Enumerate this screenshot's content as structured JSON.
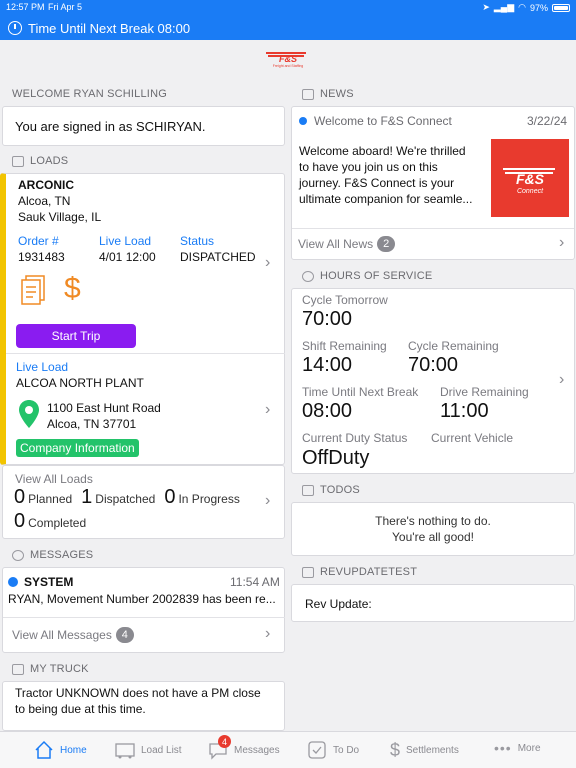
{
  "status_bar": {
    "time": "12:57 PM",
    "date": "Fri Apr 5",
    "battery": "97%"
  },
  "banner": {
    "text": "Time Until Next Break 08:00"
  },
  "logo": {
    "text": "F&S",
    "subtext": "Freight and Staffing"
  },
  "welcome": {
    "header": "WELCOME RYAN SCHILLING",
    "signed_in": "You are signed in as SCHIRYAN."
  },
  "loads": {
    "header": "LOADS",
    "customer": "ARCONIC",
    "city1": "Alcoa, TN",
    "city2": "Sauk Village, IL",
    "order_label": "Order #",
    "order_value": "1931483",
    "live_label": "Live Load",
    "live_value": "4/01 12:00",
    "status_label": "Status",
    "status_value": "DISPATCHED",
    "dollar": "$",
    "start_trip": "Start Trip",
    "stop_type": "Live Load",
    "stop_name": "ALCOA NORTH PLANT",
    "address1": "1100 East Hunt Road",
    "address2": "Alcoa, TN 37701",
    "company_info": "Company Information",
    "view_all": "View All Loads",
    "planned_count": "0",
    "planned_label": "Planned",
    "dispatched_count": "1",
    "dispatched_label": "Dispatched",
    "progress_count": "0",
    "progress_label": "In Progress",
    "completed_count": "0",
    "completed_label": "Completed"
  },
  "messages": {
    "header": "MESSAGES",
    "sender": "SYSTEM",
    "time": "11:54 AM",
    "preview": "RYAN, Movement Number 2002839 has been re...",
    "view_all": "View All Messages",
    "count": "4"
  },
  "my_truck": {
    "header": "MY TRUCK",
    "text1": "Tractor UNKNOWN does not have a PM close",
    "text2": "to being due at this time."
  },
  "news": {
    "header": "NEWS",
    "title": "Welcome to F&S Connect",
    "date": "3/22/24",
    "body1": "Welcome aboard! We're thrilled",
    "body2": "to have you join us on this",
    "body3": "journey. F&S Connect is your",
    "body4": "ultimate companion for seamle...",
    "thumb_text": "F&S",
    "thumb_sub": "Connect",
    "view_all": "View All News",
    "count": "2"
  },
  "hos": {
    "header": "HOURS OF SERVICE",
    "cycle_tomorrow_label": "Cycle Tomorrow",
    "cycle_tomorrow_value": "70:00",
    "shift_label": "Shift Remaining",
    "shift_value": "14:00",
    "cycle_label": "Cycle Remaining",
    "cycle_value": "70:00",
    "break_label": "Time Until Next Break",
    "break_value": "08:00",
    "drive_label": "Drive Remaining",
    "drive_value": "11:00",
    "duty_label": "Current Duty Status",
    "duty_value": "OffDuty",
    "vehicle_label": "Current Vehicle"
  },
  "todos": {
    "header": "TODOS",
    "line1": "There's nothing to do.",
    "line2": "You're all good!"
  },
  "revupdate": {
    "header": "REVUPDATETEST",
    "text": "Rev Update:"
  },
  "tabbar": {
    "home": "Home",
    "loads": "Load List",
    "messages": "Messages",
    "messages_badge": "4",
    "todo": "To Do",
    "settlements": "Settlements",
    "more": "More"
  },
  "colors": {
    "accent": "#1a7cf5",
    "start_trip": "#8a1cf0",
    "company_info": "#23c36a",
    "loads_bar": "#f2c400",
    "doc_icon": "#f08a24",
    "brand_red": "#e83a2e"
  }
}
